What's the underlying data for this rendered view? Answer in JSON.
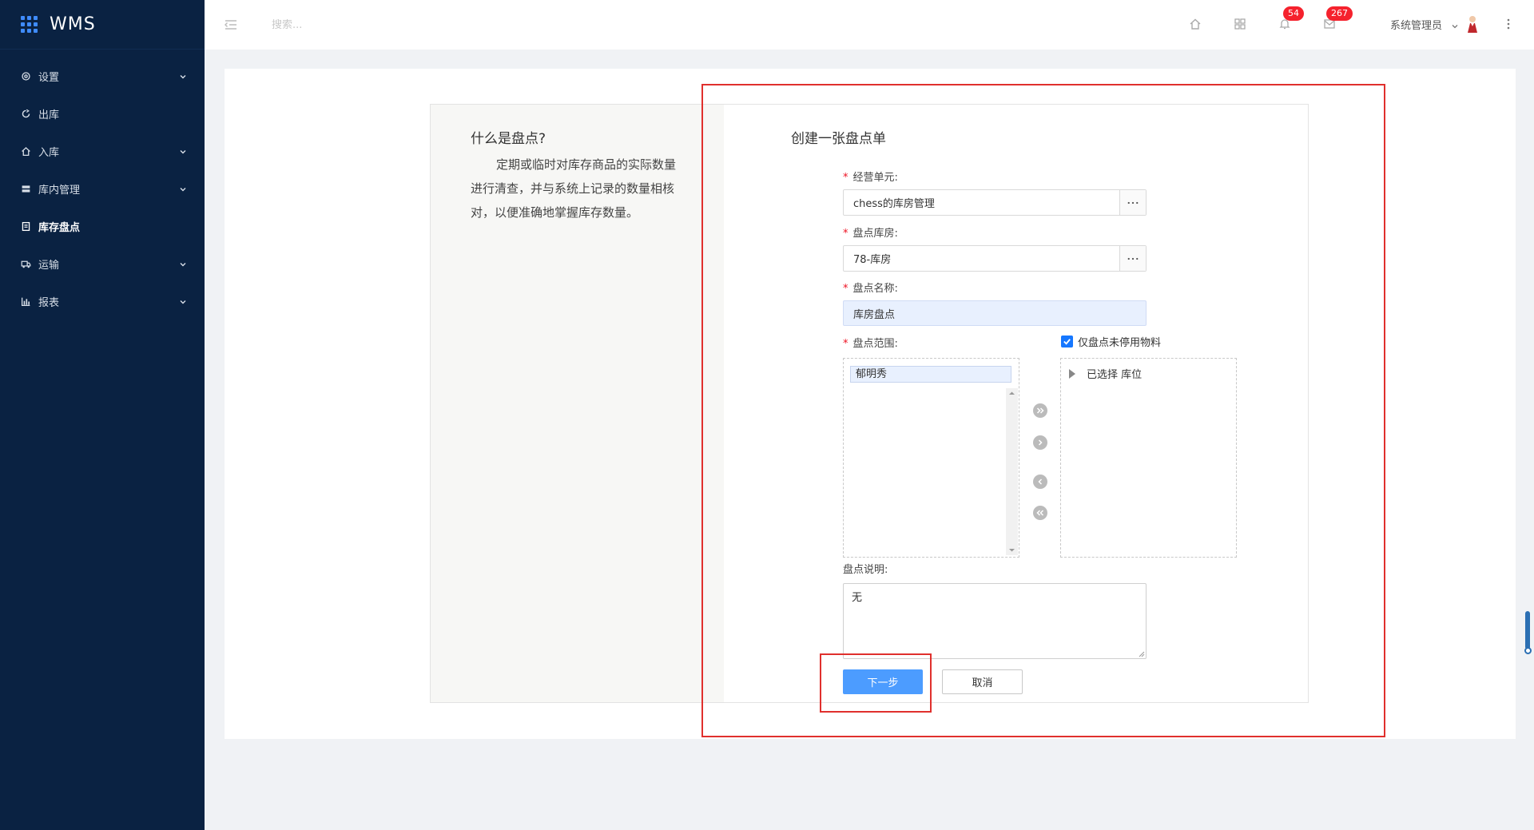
{
  "app": {
    "brand": "WMS"
  },
  "sidebar": {
    "items": [
      {
        "label": "设置",
        "icon": "gear-icon",
        "has_children": true
      },
      {
        "label": "出库",
        "icon": "outbound-icon",
        "has_children": false
      },
      {
        "label": "入库",
        "icon": "inbound-icon",
        "has_children": true
      },
      {
        "label": "库内管理",
        "icon": "warehouse-icon",
        "has_children": true
      },
      {
        "label": "库存盘点",
        "icon": "inventory-check-icon",
        "has_children": false,
        "active": true
      },
      {
        "label": "运输",
        "icon": "truck-icon",
        "has_children": true
      },
      {
        "label": "报表",
        "icon": "bar-chart-icon",
        "has_children": true
      }
    ]
  },
  "header": {
    "search_placeholder": "搜索...",
    "notifications_count": "54",
    "messages_count": "267",
    "user_name": "系统管理员"
  },
  "intro": {
    "title": "什么是盘点?",
    "description": "定期或临时对库存商品的实际数量进行清查，并与系统上记录的数量相核对，以便准确地掌握库存数量。"
  },
  "form": {
    "title": "创建一张盘点单",
    "business_unit": {
      "label": "经营单元:",
      "value": "chess的库房管理"
    },
    "warehouse": {
      "label": "盘点库房:",
      "value": "78-库房"
    },
    "name": {
      "label": "盘点名称:",
      "value": "库房盘点"
    },
    "range": {
      "label": "盘点范围:",
      "available_items": [
        "郁明秀"
      ]
    },
    "only_active": {
      "label": "仅盘点未停用物料",
      "checked": true
    },
    "selected": {
      "tree_label": "已选择 库位"
    },
    "description": {
      "label": "盘点说明:",
      "value": "无"
    },
    "next_button": "下一步",
    "cancel_button": "取消"
  },
  "colors": {
    "sidebar_bg": "#0a2242",
    "primary": "#4c9cff",
    "badge": "#f5222d",
    "annotation": "#e0302d"
  }
}
